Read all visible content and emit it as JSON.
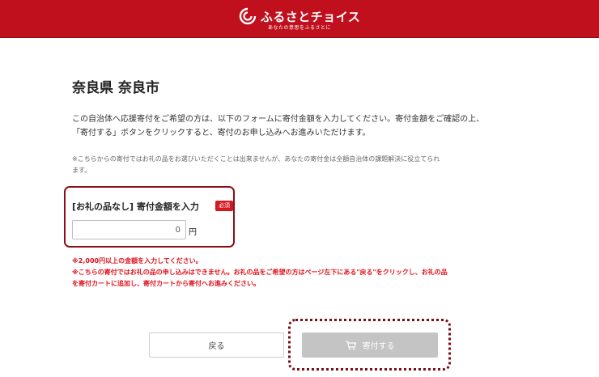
{
  "header": {
    "brand": "ふるさとチョイス",
    "tagline": "あなたの意思をふるさとに"
  },
  "page": {
    "title": "奈良県 奈良市",
    "intro_line1": "この自治体へ応援寄付をご希望の方は、以下のフォームに寄付金額を入力してください。寄付金額をご確認の上、",
    "intro_line2": "「寄付する」ボタンをクリックすると、寄付のお申し込みへお進みいただけます。",
    "note_line1": "※こちらからの寄付ではお礼の品をお選びいただくことは出来ませんが、あなたの寄付金は全額自治体の課題解決に役立てられ",
    "note_line2": "ます。"
  },
  "form": {
    "amount_label": "[お礼の品なし] 寄付金額を入力",
    "required_badge": "必須",
    "amount_value": "0",
    "unit": "円",
    "warning1": "※2,000円以上の金額を入力してください。",
    "warning2": "※こちらの寄付ではお礼の品の申し込みはできません。お礼の品をご希望の方はページ左下にある\"戻る\"をクリックし、お礼の品",
    "warning3": "を寄付カートに追加し、寄付カートから寄付へお進みください。"
  },
  "actions": {
    "back_label": "戻る",
    "donate_label": "寄付する"
  },
  "colors": {
    "brand_red": "#c0101d",
    "warning_red": "#e0101a",
    "disabled_gray": "#c4c4c4"
  },
  "icons": {
    "logo": "furusato-choice-logo-icon",
    "donate": "cart-icon"
  }
}
